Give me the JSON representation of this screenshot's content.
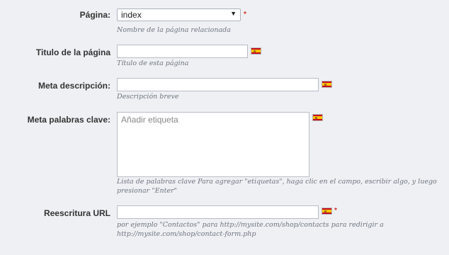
{
  "fields": {
    "page": {
      "label": "Página:",
      "selected": "index",
      "arrow": "▼",
      "required_mark": "*",
      "help": "Nombre de la página relacionada"
    },
    "title": {
      "label": "Titulo de la página",
      "value": "",
      "help": "Título de esta página"
    },
    "meta_description": {
      "label": "Meta descripción:",
      "value": "",
      "help": "Descripción breve"
    },
    "meta_keywords": {
      "label": "Meta palabras clave:",
      "placeholder": "Añadir etiqueta",
      "help_line1": "Lista de palabras clave Para agregar \"etiquetas\", haga clic en el campo, escribir algo, y luego",
      "help_line2": "presionar \"Enter\""
    },
    "url_rewrite": {
      "label": "Reescritura URL",
      "value": "",
      "required_mark": "*",
      "help_line1": "por ejemplo \"Contactos\" para http://mysite.com/shop/contacts para redirigir a",
      "help_line2": "http://mysite.com/shop/contact-form.php"
    }
  },
  "language_flag": {
    "icon": "spain-flag-icon",
    "colors": {
      "red": "#c60b1e",
      "yellow": "#ffc400"
    }
  },
  "colors": {
    "background": "#eef0f3",
    "required": "#d0302b",
    "help_text": "#6f7480"
  }
}
